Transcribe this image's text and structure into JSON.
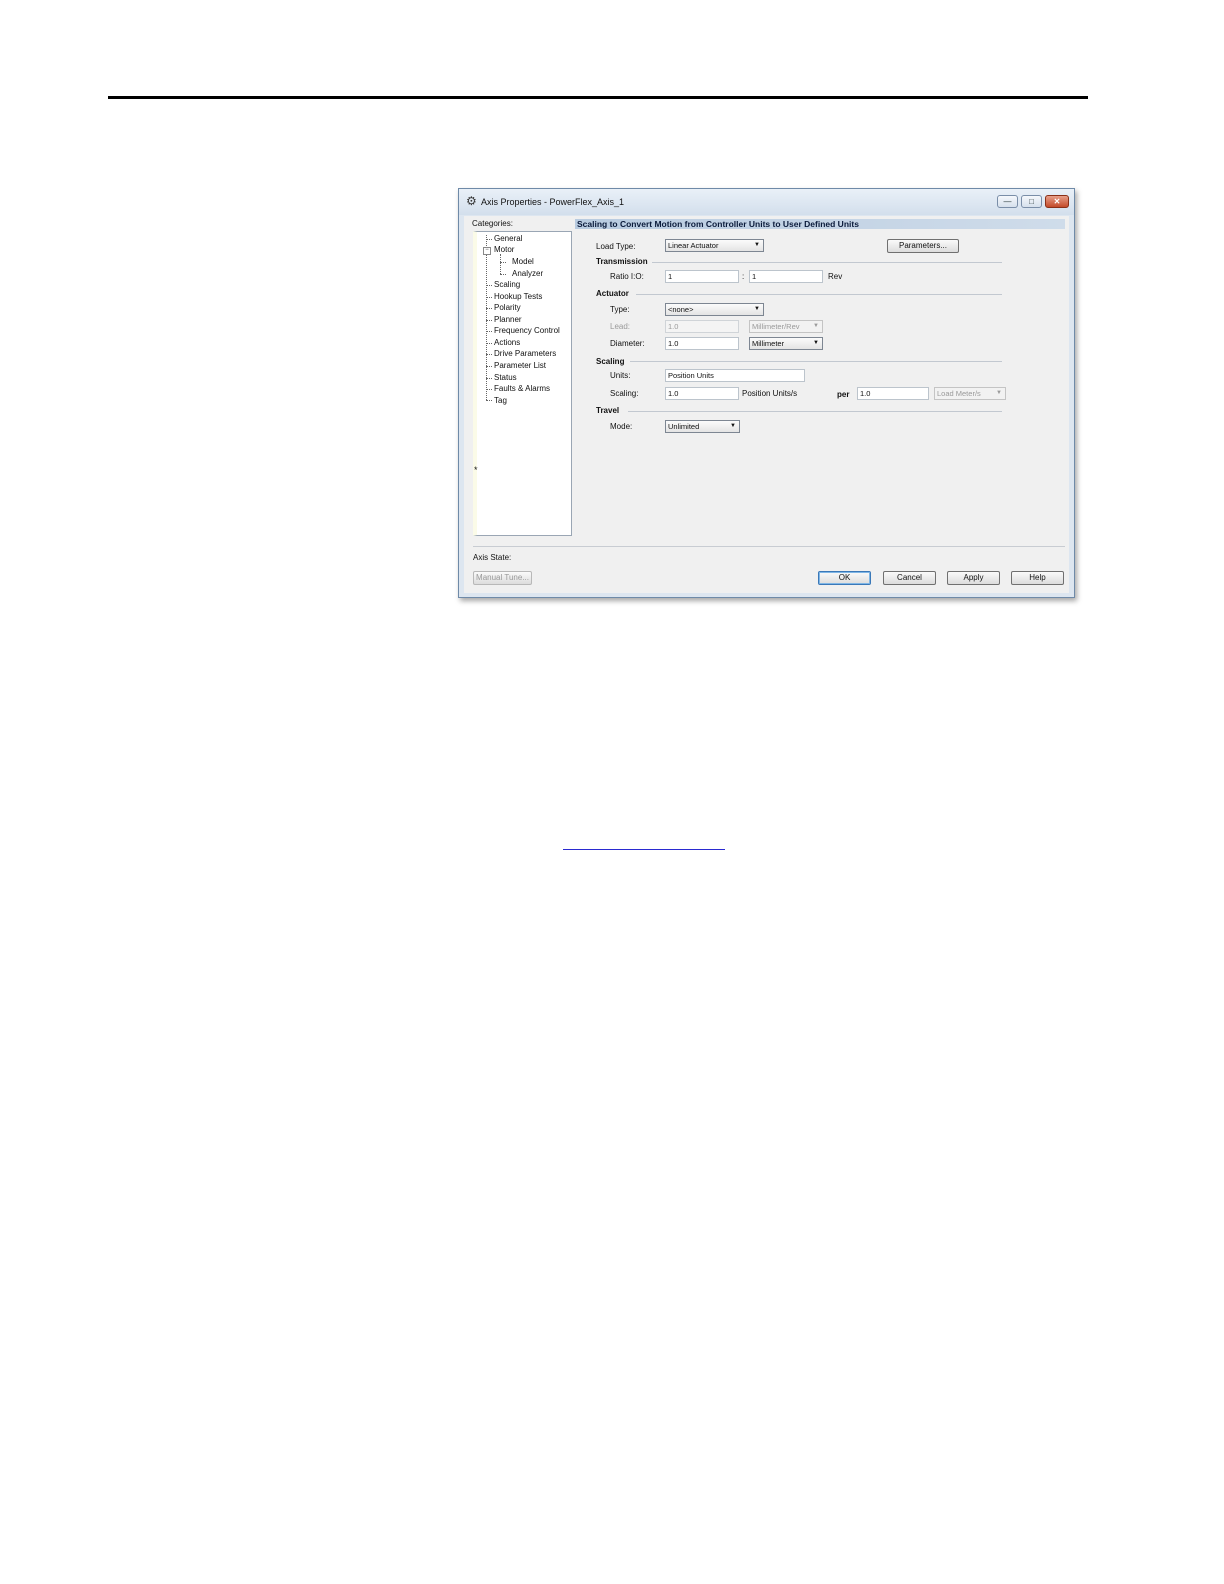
{
  "window": {
    "title": "Axis Properties - PowerFlex_Axis_1",
    "minimize_glyph": "—",
    "maximize_glyph": "□",
    "close_glyph": "✕",
    "app_icon_glyph": "⚙"
  },
  "categories": {
    "label": "Categories:",
    "items": [
      "General",
      "Motor",
      "Model",
      "Analyzer",
      "Scaling",
      "Hookup Tests",
      "Polarity",
      "Planner",
      "Frequency Control",
      "Actions",
      "Drive Parameters",
      "Parameter List",
      "Status",
      "Faults & Alarms",
      "Tag"
    ],
    "expander_glyph": "−",
    "modified_marker": "*"
  },
  "main": {
    "header": "Scaling to Convert Motion from Controller Units to User Defined Units",
    "load_type": {
      "label": "Load Type:",
      "value": "Linear Actuator"
    },
    "parameters_button": "Parameters...",
    "transmission": {
      "title": "Transmission",
      "ratio_label": "Ratio I:O:",
      "ratio_in": "1",
      "separator": ":",
      "ratio_out": "1",
      "unit": "Rev"
    },
    "actuator": {
      "title": "Actuator",
      "type_label": "Type:",
      "type_value": "<none>",
      "lead_label": "Lead:",
      "lead_value": "1.0",
      "lead_unit": "Millimeter/Rev",
      "diameter_label": "Diameter:",
      "diameter_value": "1.0",
      "diameter_unit": "Millimeter"
    },
    "scaling": {
      "title": "Scaling",
      "units_label": "Units:",
      "units_value": "Position Units",
      "scaling_label": "Scaling:",
      "scaling_value": "1.0",
      "scaling_unit": "Position Units/s",
      "per_label": "per",
      "per_value": "1.0",
      "per_unit": "Load Meter/s"
    },
    "travel": {
      "title": "Travel",
      "mode_label": "Mode:",
      "mode_value": "Unlimited"
    },
    "dropdown_glyph": "▼"
  },
  "footer": {
    "axis_state_label": "Axis State:",
    "manual_tune": "Manual Tune...",
    "ok": "OK",
    "cancel": "Cancel",
    "apply": "Apply",
    "help": "Help"
  }
}
